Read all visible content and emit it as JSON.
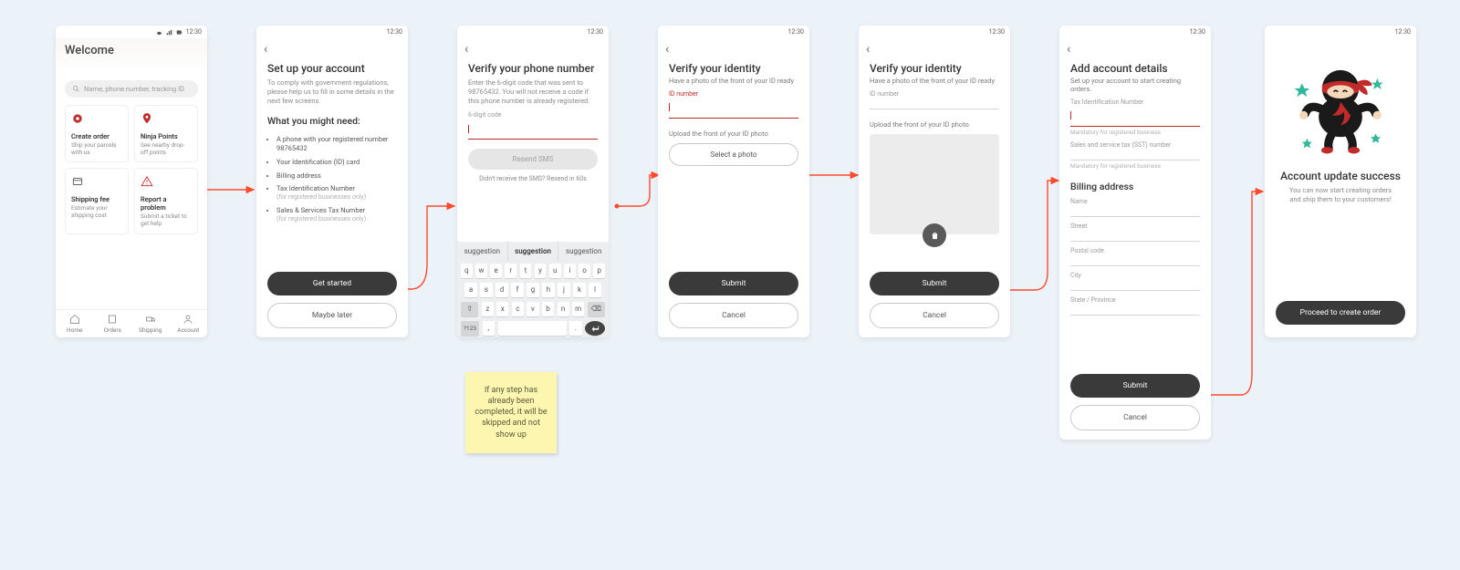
{
  "status": {
    "time": "12:30"
  },
  "sticky_note": "If any step has already been completed, it will be skipped and not show up",
  "home": {
    "title": "Welcome",
    "search_placeholder": "Name, phone number, tracking ID",
    "cards": [
      {
        "title": "Create order",
        "sub": "Ship your parcels with us"
      },
      {
        "title": "Ninja Points",
        "sub": "See nearby drop-off points"
      },
      {
        "title": "Shipping fee",
        "sub": "Estimate your shipping cost"
      },
      {
        "title": "Report a problem",
        "sub": "Submit a ticket to get help"
      }
    ],
    "tabs": [
      "Home",
      "Orders",
      "Shipping",
      "Account"
    ]
  },
  "setup": {
    "title": "Set up your account",
    "intro": "To comply with government regulations, please help us to fill in some details in the next few screens.",
    "need_title": "What you might need:",
    "items": [
      {
        "t": "A phone with your registered number 98765432"
      },
      {
        "t": "Your Identification (ID) card"
      },
      {
        "t": "Billing address"
      },
      {
        "t": "Tax Identification Number",
        "hint": "(for registered businesses only)"
      },
      {
        "t": "Sales & Services Tax Number",
        "hint": "(for registered businesses only)"
      }
    ],
    "get_started": "Get started",
    "maybe_later": "Maybe later"
  },
  "verify_phone": {
    "title": "Verify your phone number",
    "intro": "Enter the 6-digit code that was sent to 98765432. You will not receive a code if this phone number is already registered.",
    "code_label": "6-digit code",
    "resend": "Resend SMS",
    "resend_hint": "Didn't receive the SMS? Resend in 60s",
    "kb_sug": [
      "suggestion",
      "suggestion",
      "suggestion"
    ],
    "kb_r1": [
      "q",
      "w",
      "e",
      "r",
      "t",
      "y",
      "u",
      "i",
      "o",
      "p"
    ],
    "kb_r2": [
      "a",
      "s",
      "d",
      "f",
      "g",
      "h",
      "j",
      "k",
      "l"
    ],
    "kb_r3_l": "⇧",
    "kb_r3": [
      "z",
      "x",
      "c",
      "v",
      "b",
      "n",
      "m"
    ],
    "kb_r3_r": "⌫",
    "kb_sym": "?123",
    "kb_go": "↵"
  },
  "verify_id_a": {
    "title": "Verify your identity",
    "sub": "Have a photo of the front of your ID ready",
    "id_label": "ID number",
    "upload_label": "Upload the front of your ID photo",
    "select": "Select a photo",
    "submit": "Submit",
    "cancel": "Cancel"
  },
  "verify_id_b": {
    "title": "Verify your identity",
    "sub": "Have a photo of the front of your ID ready",
    "id_label": "ID number",
    "upload_label": "Upload the front of your ID photo",
    "submit": "Submit",
    "cancel": "Cancel"
  },
  "details": {
    "title": "Add account details",
    "sub": "Set up your account to start creating orders.",
    "tin_label": "Tax Identification Number",
    "hint1": "Mandatory for registered business",
    "sst_label": "Sales and service tax (SST) number",
    "hint2": "Mandatory for registered business",
    "billing_h": "Billing address",
    "fields": [
      "Name",
      "Street",
      "Postal code",
      "City",
      "State / Province"
    ],
    "submit": "Submit",
    "cancel": "Cancel"
  },
  "success": {
    "title": "Account update success",
    "body": "You can now start creating orders and ship them to your customers!",
    "cta": "Proceed to create order"
  }
}
